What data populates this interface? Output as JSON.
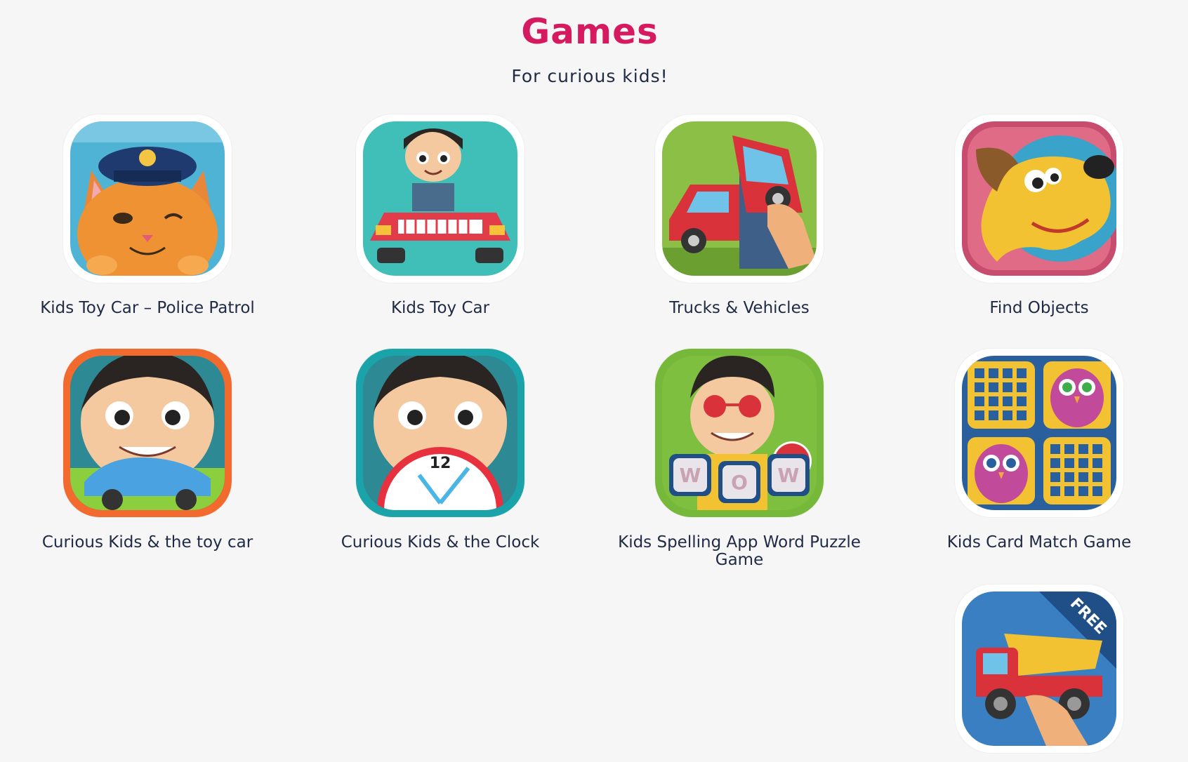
{
  "header": {
    "title": "Games",
    "subtitle": "For curious kids!"
  },
  "games": [
    {
      "label": "Kids Toy Car – Police Patrol",
      "icon": "police-cat-icon"
    },
    {
      "label": "Kids Toy Car",
      "icon": "boy-red-car-icon"
    },
    {
      "label": "Trucks & Vehicles",
      "icon": "car-puzzle-icon"
    },
    {
      "label": "Find Objects",
      "icon": "yellow-dog-icon"
    },
    {
      "label": "Curious Kids & the toy car",
      "icon": "boy-blue-car-icon"
    },
    {
      "label": "Curious Kids & the Clock",
      "icon": "boy-clock-icon"
    },
    {
      "label": "Kids Spelling App Word Puzzle Game",
      "icon": "wow-letters-icon"
    },
    {
      "label": "Kids Card Match Game",
      "icon": "owl-cards-icon"
    },
    {
      "label": "",
      "icon": "dump-truck-free-icon",
      "badge": "FREE"
    }
  ],
  "colors": {
    "title": "#d61a5f",
    "text": "#1f2a44",
    "background": "#f6f6f6"
  }
}
